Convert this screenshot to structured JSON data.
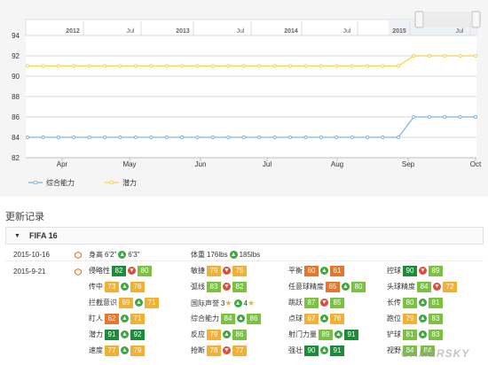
{
  "chart_data": {
    "type": "line",
    "title": "",
    "xlabel": "",
    "ylabel": "",
    "ylim": [
      82,
      94
    ],
    "yticks": [
      82,
      84,
      86,
      88,
      90,
      92,
      94
    ],
    "x_months": [
      "Apr",
      "May",
      "Jun",
      "Jul",
      "Aug",
      "Sep",
      "Oct"
    ],
    "navigator_labels": [
      "2012",
      "Jul",
      "2013",
      "Jul",
      "2014",
      "Jul",
      "2015",
      "Jul"
    ],
    "grid": true,
    "legend_position": "bottom-left",
    "series": [
      {
        "name": "综合能力",
        "color": "#7fb5e3",
        "values": [
          84,
          84,
          84,
          84,
          84,
          84,
          84,
          84,
          84,
          84,
          84,
          84,
          84,
          84,
          84,
          84,
          84,
          84,
          84,
          84,
          84,
          84,
          84,
          84,
          84,
          86,
          86,
          86,
          86,
          86
        ]
      },
      {
        "name": "潜力",
        "color": "#f3d44e",
        "values": [
          91,
          91,
          91,
          91,
          91,
          91,
          91,
          91,
          91,
          91,
          91,
          91,
          91,
          91,
          91,
          91,
          91,
          91,
          91,
          91,
          91,
          91,
          91,
          91,
          91,
          92,
          92,
          92,
          92,
          92
        ]
      }
    ]
  },
  "updates": {
    "section_title": "更新记录",
    "group_label": "FIFA 16",
    "entries": [
      {
        "date": "2015-10-16",
        "attrs": [
          {
            "name": "身高",
            "old": "6'2\"",
            "new": "6'3\"",
            "dir": "up",
            "style": "plain"
          },
          {
            "name": "体重",
            "old": "176lbs",
            "new": "185lbs",
            "dir": "up",
            "style": "plain"
          }
        ]
      },
      {
        "date": "2015-9-21",
        "attrs": [
          {
            "name": "侵略性",
            "old": "82",
            "new": "80",
            "dir": "down",
            "oc": "b-dg",
            "nc": "b-lg"
          },
          {
            "name": "敏捷",
            "old": "79",
            "new": "75",
            "dir": "down",
            "oc": "b-y",
            "nc": "b-y"
          },
          {
            "name": "平衡",
            "old": "60",
            "new": "61",
            "dir": "up",
            "oc": "b-o",
            "nc": "b-o"
          },
          {
            "name": "控球",
            "old": "90",
            "new": "89",
            "dir": "down",
            "oc": "b-dg",
            "nc": "b-lg"
          },
          {
            "name": "传中",
            "old": "73",
            "new": "76",
            "dir": "up",
            "oc": "b-y",
            "nc": "b-y"
          },
          {
            "name": "弧线",
            "old": "83",
            "new": "82",
            "dir": "down",
            "oc": "b-lg",
            "nc": "b-lg"
          },
          {
            "name": "任意球精度",
            "old": "65",
            "new": "80",
            "dir": "up",
            "oc": "b-o",
            "nc": "b-lg"
          },
          {
            "name": "头球精度",
            "old": "84",
            "new": "72",
            "dir": "down",
            "oc": "b-lg",
            "nc": "b-y"
          },
          {
            "name": "拦截意识",
            "old": "69",
            "new": "71",
            "dir": "up",
            "oc": "b-y",
            "nc": "b-y"
          },
          {
            "name": "国际声誉",
            "old": "3",
            "new": "4",
            "dir": "up",
            "style": "star"
          },
          {
            "name": "跳跃",
            "old": "87",
            "new": "85",
            "dir": "down",
            "oc": "b-lg",
            "nc": "b-lg"
          },
          {
            "name": "长传",
            "old": "80",
            "new": "81",
            "dir": "up",
            "oc": "b-lg",
            "nc": "b-lg"
          },
          {
            "name": "盯人",
            "old": "62",
            "new": "71",
            "dir": "up",
            "oc": "b-o",
            "nc": "b-y"
          },
          {
            "name": "综合能力",
            "old": "84",
            "new": "86",
            "dir": "up",
            "oc": "b-lg",
            "nc": "b-lg"
          },
          {
            "name": "点球",
            "old": "67",
            "new": "76",
            "dir": "up",
            "oc": "b-y",
            "nc": "b-y"
          },
          {
            "name": "跑位",
            "old": "79",
            "new": "83",
            "dir": "up",
            "oc": "b-y",
            "nc": "b-lg"
          },
          {
            "name": "潜力",
            "old": "91",
            "new": "92",
            "dir": "up",
            "oc": "b-dg",
            "nc": "b-dg"
          },
          {
            "name": "反应",
            "old": "79",
            "new": "86",
            "dir": "up",
            "oc": "b-y",
            "nc": "b-lg"
          },
          {
            "name": "射门力量",
            "old": "89",
            "new": "91",
            "dir": "up",
            "oc": "b-lg",
            "nc": "b-dg"
          },
          {
            "name": "铲球",
            "old": "81",
            "new": "83",
            "dir": "up",
            "oc": "b-lg",
            "nc": "b-lg"
          },
          {
            "name": "速度",
            "old": "77",
            "new": "79",
            "dir": "up",
            "oc": "b-y",
            "nc": "b-y"
          },
          {
            "name": "抢断",
            "old": "78",
            "new": "77",
            "dir": "down",
            "oc": "b-y",
            "nc": "b-y"
          },
          {
            "name": "强壮",
            "old": "90",
            "new": "91",
            "dir": "up",
            "oc": "b-dg",
            "nc": "b-dg"
          },
          {
            "name": "视野",
            "old": "84",
            "new": "84",
            "dir": "none",
            "oc": "b-lg",
            "nc": "b-lg"
          }
        ]
      }
    ]
  },
  "watermark": "GAMERSKY"
}
